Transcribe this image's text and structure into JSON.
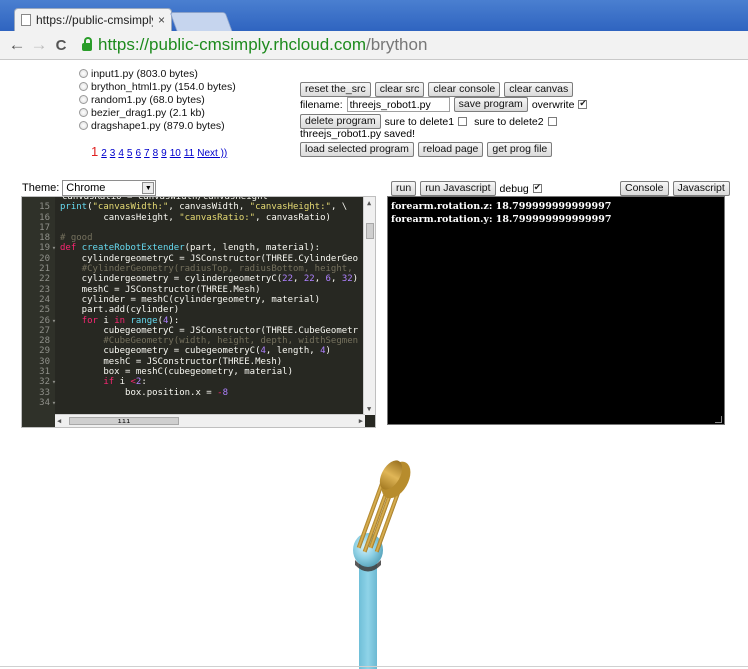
{
  "browser": {
    "tab_title": "https://public-cmsimply.",
    "tab_close": "×",
    "url_scheme": "https://",
    "url_host": "public-cmsimply.rhcloud.com",
    "url_path": "/brython",
    "back": "←",
    "forward": "→",
    "reload": "C"
  },
  "files": [
    {
      "label": "input1.py (803.0 bytes)"
    },
    {
      "label": "brython_html1.py (154.0 bytes)"
    },
    {
      "label": "random1.py (68.0 bytes)"
    },
    {
      "label": "bezier_drag1.py (2.1 kb)"
    },
    {
      "label": "dragshape1.py (879.0 bytes)"
    }
  ],
  "pager": {
    "current": "1",
    "pages": [
      "2",
      "3",
      "4",
      "5",
      "6",
      "7",
      "8",
      "9",
      "10",
      "11"
    ],
    "next": "Next ))"
  },
  "controls": {
    "reset_src": "reset the_src",
    "clear_src": "clear src",
    "clear_console": "clear console",
    "clear_canvas": "clear canvas",
    "filename_label": "filename:",
    "filename_value": "threejs_robot1.py",
    "save_program": "save program",
    "overwrite_label": "overwrite",
    "delete_program": "delete program",
    "sure_delete1": "sure to delete1",
    "sure_delete2": "sure to delete2",
    "saved_msg": "threejs_robot1.py saved!",
    "load_selected": "load selected program",
    "reload_page": "reload page",
    "get_prog_file": "get prog file"
  },
  "theme": {
    "label": "Theme:",
    "value": "Chrome"
  },
  "runbar": {
    "run": "run",
    "run_js": "run Javascript",
    "debug_label": "debug",
    "console_btn": "Console",
    "javascript_btn": "Javascript"
  },
  "editor_lines": [
    {
      "n": "",
      "fold": "",
      "html": "<span class='code'>canvasRatio = canvasWidth/canvasHeight</span>"
    },
    {
      "n": "15",
      "fold": "",
      "html": "<span class='f'>print</span>(<span class='s'>\"canvasWidth:\"</span>, canvasWidth, <span class='s'>\"canvasHeight:\"</span>, \\"
    },
    {
      "n": "16",
      "fold": "",
      "html": "        canvasHeight, <span class='s'>\"canvasRatio:\"</span>, canvasRatio)"
    },
    {
      "n": "17",
      "fold": "",
      "html": ""
    },
    {
      "n": "18",
      "fold": "",
      "html": "<span class='c'># good</span>"
    },
    {
      "n": "19",
      "fold": "▾",
      "html": "<span class='k'>def</span> <span class='f'>createRobotExtender</span>(part, length, material):"
    },
    {
      "n": "20",
      "fold": "",
      "html": "    cylindergeometryC = JSConstructor(THREE.CylinderGeo"
    },
    {
      "n": "21",
      "fold": "",
      "html": "    <span class='c'>#CylinderGeometry(radiusTop, radiusBottom, height,</span>"
    },
    {
      "n": "22",
      "fold": "",
      "html": "    cylindergeometry = cylindergeometryC(<span class='n'>22</span>, <span class='n'>22</span>, <span class='n'>6</span>, <span class='n'>32</span>)"
    },
    {
      "n": "23",
      "fold": "",
      "html": "    meshC = JSConstructor(THREE.Mesh)"
    },
    {
      "n": "24",
      "fold": "",
      "html": "    cylinder = meshC(cylindergeometry, material)"
    },
    {
      "n": "25",
      "fold": "",
      "html": "    part.add(cylinder)"
    },
    {
      "n": "26",
      "fold": "▾",
      "html": "    <span class='k'>for</span> i <span class='k'>in</span> <span class='f'>range</span>(<span class='n'>4</span>):"
    },
    {
      "n": "27",
      "fold": "",
      "html": "        cubegeometryC = JSConstructor(THREE.CubeGeometr"
    },
    {
      "n": "28",
      "fold": "",
      "html": "        <span class='c'>#CubeGeometry(width, height, depth, widthSegmen</span>"
    },
    {
      "n": "29",
      "fold": "",
      "html": "        cubegeometry = cubegeometryC(<span class='n'>4</span>, length, <span class='n'>4</span>)"
    },
    {
      "n": "30",
      "fold": "",
      "html": "        meshC = JSConstructor(THREE.Mesh)"
    },
    {
      "n": "31",
      "fold": "",
      "html": "        box = meshC(cubegeometry, material)"
    },
    {
      "n": "32",
      "fold": "▾",
      "html": "        <span class='k'>if</span> i <span class='k'>&lt;</span><span class='n'>2</span>:"
    },
    {
      "n": "33",
      "fold": "",
      "html": "            box.position.x = <span class='k'>-</span><span class='n'>8</span>"
    },
    {
      "n": "34",
      "fold": "▾",
      "html": ""
    }
  ],
  "console_output": [
    "forearm.rotation.z: 18.799999999999997",
    "forearm.rotation.y: 18.799999999999997"
  ],
  "colors": {
    "robot_arm": "#80c8de",
    "robot_gold": "#c79a35"
  }
}
